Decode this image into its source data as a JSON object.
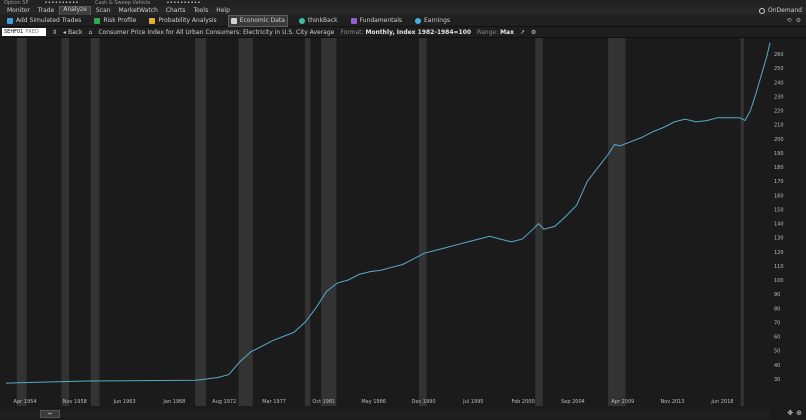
{
  "window": {
    "left_label": "Option SP",
    "center_label": "Cash & Sweep Vehicle",
    "masked": "••••••••••"
  },
  "menu": {
    "items": [
      "Monitor",
      "Trade",
      "Analyze",
      "Scan",
      "MarketWatch",
      "Charts",
      "Tools",
      "Help"
    ],
    "active": "Analyze",
    "right_label": "OnDemand"
  },
  "toolbar": {
    "items": [
      {
        "label": "Add Simulated Trades",
        "icon": "plus-icon",
        "color": "#3aa0e0"
      },
      {
        "label": "Risk Profile",
        "icon": "risk-icon",
        "color": "#2fa84f"
      },
      {
        "label": "Probability Analysis",
        "icon": "probability-icon",
        "color": "#e0b030"
      },
      {
        "label": "Economic Data",
        "icon": "bank-icon",
        "color": "#d0d0d0"
      },
      {
        "label": "thinkBack",
        "icon": "clock-icon",
        "color": "#3ac0a0"
      },
      {
        "label": "Fundamentals",
        "icon": "fundamentals-icon",
        "color": "#9a5ad0"
      },
      {
        "label": "Earnings",
        "icon": "bulb-icon",
        "color": "#4ab0e0"
      }
    ],
    "active": "Economic Data"
  },
  "subbar": {
    "symbol": "SEHF01",
    "source": "FRED",
    "back_label": "Back",
    "title": "Consumer Price Index for All Urban Consumers: Electricity in U.S. City Average",
    "format_label": "Format:",
    "format_value": "Monthly, Index 1982-1984=100",
    "range_label": "Range:",
    "range_value": "Max"
  },
  "chart_data": {
    "type": "line",
    "line_color": "#5aa9c8",
    "background": "#1b1b1b",
    "band_color": "#333333",
    "x_range": [
      1952.5,
      2022.8
    ],
    "ylim": [
      20,
      270
    ],
    "y_ticks": [
      30,
      40,
      50,
      60,
      70,
      80,
      90,
      100,
      110,
      120,
      130,
      140,
      150,
      160,
      170,
      180,
      190,
      200,
      210,
      220,
      230,
      240,
      250,
      260
    ],
    "x_ticks": [
      {
        "label": "Apr 1954",
        "x": 1954.25
      },
      {
        "label": "Nov 1958",
        "x": 1958.83
      },
      {
        "label": "Jun 1963",
        "x": 1963.42
      },
      {
        "label": "Jan 1968",
        "x": 1968.0
      },
      {
        "label": "Aug 1972",
        "x": 1972.58
      },
      {
        "label": "Mar 1977",
        "x": 1977.17
      },
      {
        "label": "Oct 1981",
        "x": 1981.75
      },
      {
        "label": "May 1986",
        "x": 1986.33
      },
      {
        "label": "Dec 1990",
        "x": 1990.92
      },
      {
        "label": "Jul 1995",
        "x": 1995.5
      },
      {
        "label": "Feb 2000",
        "x": 2000.08
      },
      {
        "label": "Sep 2004",
        "x": 2004.67
      },
      {
        "label": "Apr 2009",
        "x": 2009.25
      },
      {
        "label": "Nov 2013",
        "x": 2013.83
      },
      {
        "label": "Jun 2018",
        "x": 2018.42
      }
    ],
    "recessions": [
      [
        1953.5,
        1954.4
      ],
      [
        1957.6,
        1958.3
      ],
      [
        1960.3,
        1961.1
      ],
      [
        1969.9,
        1970.9
      ],
      [
        1973.9,
        1975.2
      ],
      [
        1980.0,
        1980.5
      ],
      [
        1981.5,
        1982.9
      ],
      [
        1990.5,
        1991.2
      ],
      [
        2001.2,
        2001.9
      ],
      [
        2007.9,
        2009.5
      ],
      [
        2020.1,
        2020.4
      ]
    ],
    "series": [
      {
        "x": [
          1952.5,
          1955,
          1960,
          1965,
          1970,
          1972,
          1973,
          1974,
          1975,
          1976,
          1977,
          1978,
          1979,
          1980,
          1981,
          1982,
          1983,
          1984,
          1985,
          1986,
          1987,
          1988,
          1989,
          1990,
          1991,
          1992,
          1993,
          1994,
          1995,
          1996,
          1997,
          1998,
          1999,
          2000,
          2001,
          2001.5,
          2002,
          2003,
          2004,
          2005,
          2006,
          2007,
          2008,
          2008.5,
          2009,
          2010,
          2011,
          2012,
          2013,
          2014,
          2015,
          2016,
          2017,
          2018,
          2019,
          2020,
          2020.5,
          2021,
          2021.5,
          2022,
          2022.5,
          2022.8
        ],
        "y": [
          27,
          27.5,
          28.5,
          28.8,
          29,
          31,
          33,
          42,
          49,
          53,
          57,
          60,
          63,
          70,
          80,
          92,
          98,
          100,
          104,
          106,
          107,
          109,
          111,
          115,
          119,
          121,
          123,
          125,
          127,
          129,
          131,
          129,
          127,
          129,
          136,
          140,
          136,
          138,
          145,
          153,
          170,
          180,
          190,
          196,
          195,
          198,
          201,
          205,
          208,
          212,
          214,
          212,
          213,
          215,
          215,
          215,
          213,
          220,
          232,
          245,
          258,
          268
        ]
      }
    ]
  }
}
